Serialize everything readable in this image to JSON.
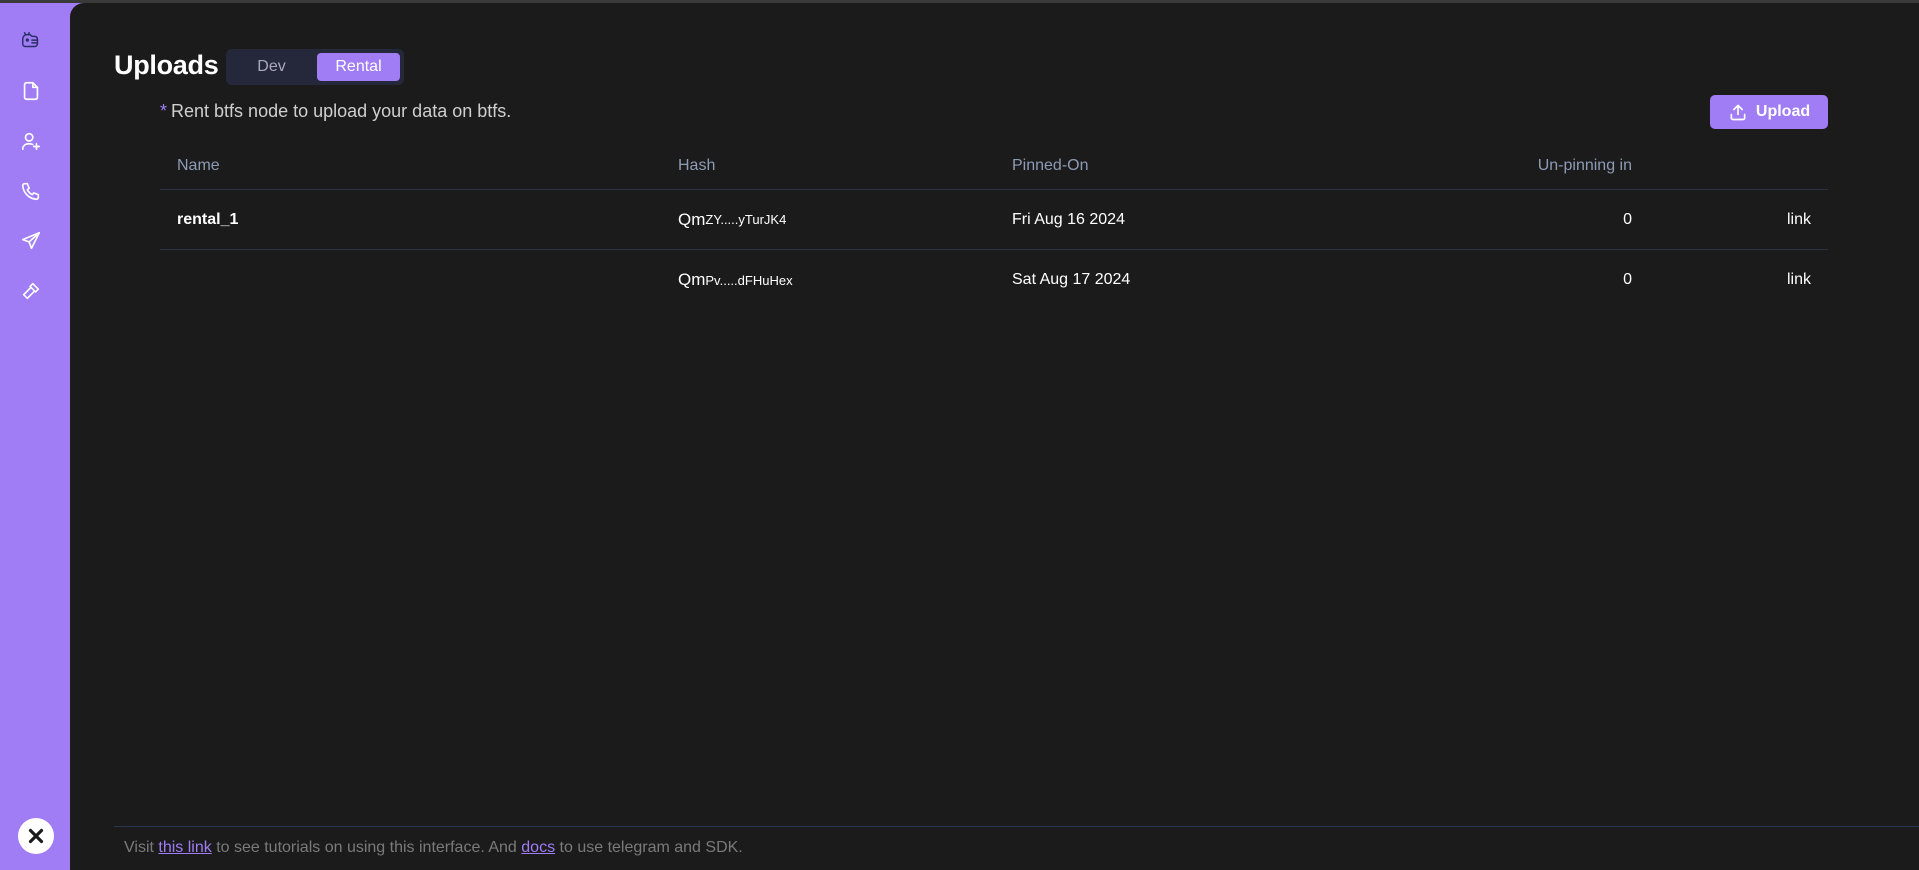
{
  "sidebar": {
    "items": [
      {
        "icon": "logo-icon"
      },
      {
        "icon": "file-icon"
      },
      {
        "icon": "user-plus-icon"
      },
      {
        "icon": "phone-icon"
      },
      {
        "icon": "send-icon"
      },
      {
        "icon": "hammer-icon"
      }
    ],
    "close_icon": "close-icon"
  },
  "header": {
    "title": "Uploads",
    "toggle": {
      "options": [
        "Dev",
        "Rental"
      ],
      "selected": "Rental"
    }
  },
  "note": {
    "star": "*",
    "text": "Rent btfs node to upload your data on btfs."
  },
  "upload_button": {
    "label": "Upload",
    "icon": "upload-icon"
  },
  "table": {
    "columns": [
      "Name",
      "Hash",
      "Pinned-On",
      "Un-pinning in",
      ""
    ],
    "rows": [
      {
        "name": "rental_1",
        "hash_prefix": "Qm",
        "hash_rest": "ZY.....yTurJK4",
        "pinned_on": "Fri Aug 16 2024",
        "unpin": "0",
        "link": "link"
      },
      {
        "name": "",
        "hash_prefix": "Qm",
        "hash_rest": "Pv.....dFHuHex",
        "pinned_on": "Sat Aug 17 2024",
        "unpin": "0",
        "link": "link"
      }
    ]
  },
  "footer": {
    "prefix": "Visit",
    "link1": "this link",
    "middle": "to see tutorials on using this interface. And",
    "link2": "docs",
    "suffix": "to use telegram and SDK."
  },
  "colors": {
    "accent": "#a07cf5",
    "background": "#1b1b1b"
  }
}
